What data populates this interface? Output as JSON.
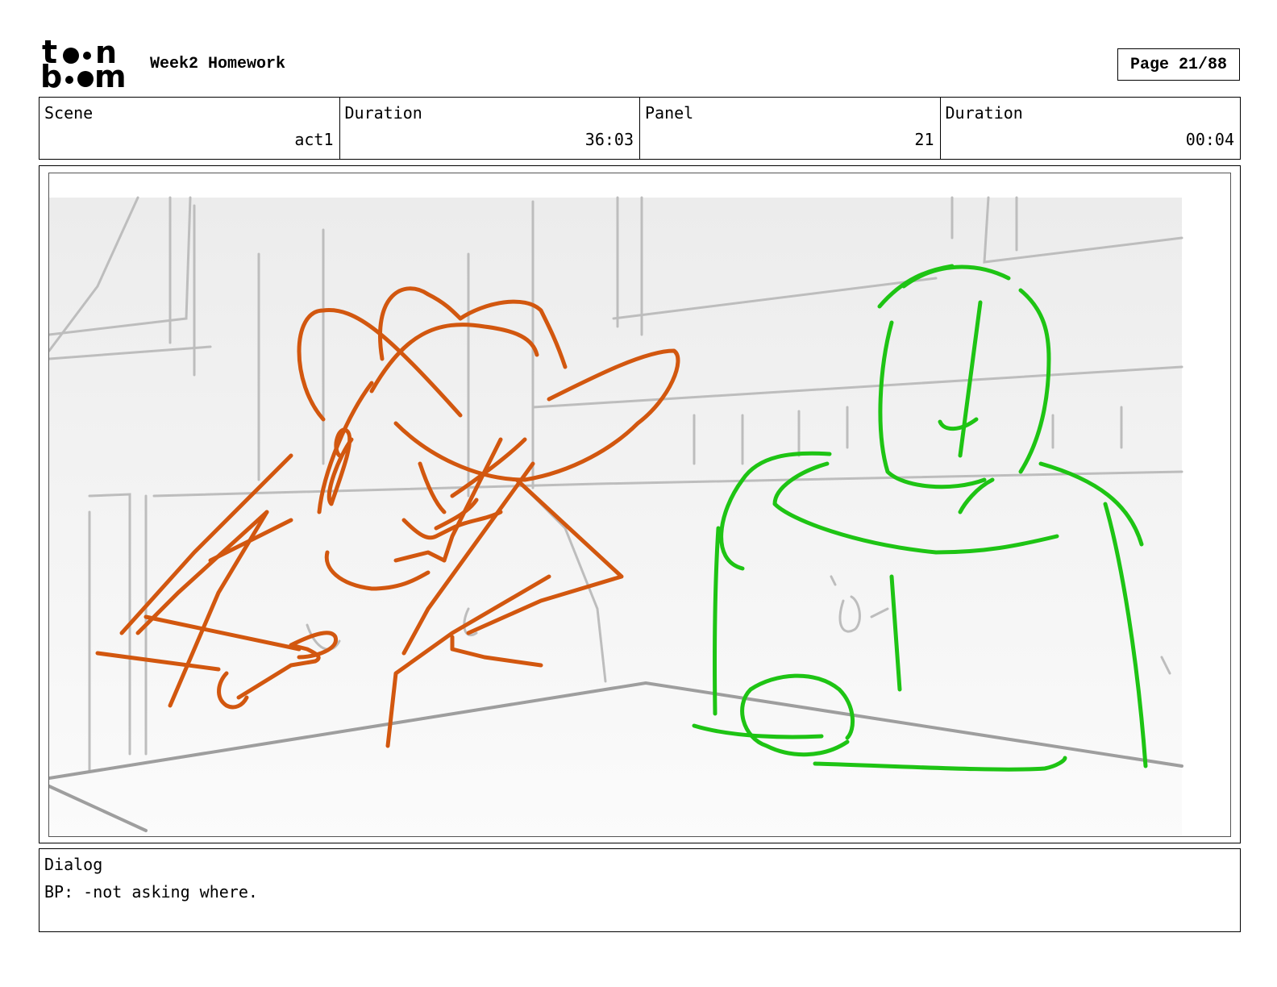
{
  "header": {
    "logo_text": "toon boom",
    "title": "Week2 Homework",
    "page": "Page 21/88"
  },
  "info": {
    "scene_label": "Scene",
    "scene_value": "act1",
    "duration_label": "Duration",
    "duration_value": "36:03",
    "panel_label": "Panel",
    "panel_value": "21",
    "panel_duration_label": "Duration",
    "panel_duration_value": "00:04"
  },
  "dialog": {
    "label": "Dialog",
    "text": "BP: -not asking where."
  },
  "colors": {
    "character_left": "#d2570f",
    "character_right": "#1ec414",
    "background_lines": "#bdbdbd"
  }
}
